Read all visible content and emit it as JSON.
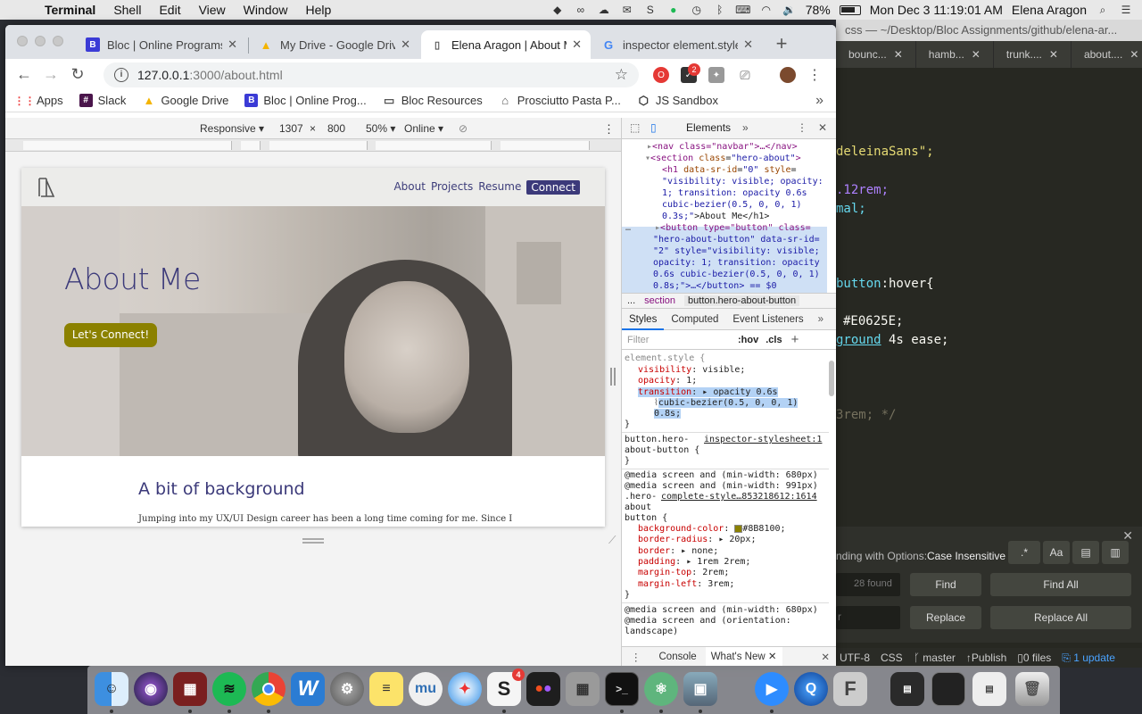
{
  "menubar": {
    "app": "Terminal",
    "menus": [
      "Shell",
      "Edit",
      "View",
      "Window",
      "Help"
    ],
    "battery": "78%",
    "datetime": "Mon Dec 3  11:19:01 AM",
    "user": "Elena Aragon"
  },
  "editor": {
    "title": "css — ~/Desktop/Bloc Assignments/github/elena-ar...",
    "tabs": [
      "bounc...",
      "hamb...",
      "trunk....",
      "about...."
    ],
    "code": {
      "l1": "deleinaSans\";",
      "l2": ".12rem;",
      "l3": "mal;",
      "l4_sel": "button",
      "l4_pseudo": ":hover{",
      "l5": "#E0625E;",
      "l6_prop": "ground",
      "l6_val": " 4s ease;",
      "l7": "3rem; */"
    },
    "find": {
      "options_label": "nding with Options:",
      "options_value": "Case Insensitive",
      "regex": ".*",
      "case": "Aa",
      "found": "28 found",
      "replace_ph": "r",
      "find": "Find",
      "find_all": "Find All",
      "replace": "Replace",
      "replace_all": "Replace All"
    },
    "status": {
      "encoding": "UTF-8",
      "grammar": "CSS",
      "branch": "master",
      "publish": "Publish",
      "files": "0 files",
      "update": "1 update"
    }
  },
  "chrome": {
    "tabs": [
      {
        "label": "Bloc | Online Programs",
        "favicon": "B"
      },
      {
        "label": "My Drive - Google Drive",
        "favicon": "▲"
      },
      {
        "label": "Elena Aragon | About Me",
        "favicon": "📄"
      },
      {
        "label": "inspector element.style",
        "favicon": "G"
      }
    ],
    "url_host": "127.0.0.1",
    "url_path": ":3000/about.html",
    "ext_badge": "2",
    "bookmarks": [
      {
        "label": "Apps",
        "icon": "apps-icon"
      },
      {
        "label": "Slack",
        "icon": "slack-icon"
      },
      {
        "label": "Google Drive",
        "icon": "drive-icon"
      },
      {
        "label": "Bloc | Online Prog...",
        "icon": "bloc-icon"
      },
      {
        "label": "Bloc Resources",
        "icon": "folder-icon"
      },
      {
        "label": "Prosciutto Pasta P...",
        "icon": "page-icon"
      },
      {
        "label": "JS Sandbox",
        "icon": "codepen-icon"
      }
    ]
  },
  "device": {
    "mode": "Responsive",
    "width": "1307",
    "times": "×",
    "height": "800",
    "zoom": "50%",
    "network": "Online"
  },
  "site": {
    "nav": [
      "About",
      "Projects",
      "Resume",
      "Connect"
    ],
    "hero_title": "About Me",
    "cta": "Let's Connect!",
    "section_title": "A bit of background",
    "paragraph": "Jumping into my UX/UI Design career has been a long time coming for me. Since I"
  },
  "devtools": {
    "panel": "Elements",
    "dom": {
      "nav": "<nav class=\"navbar\">…</nav>",
      "section_open_tag": "section",
      "section_class": "hero-about",
      "h1_attr": "data-sr-id",
      "h1_id": "\"0\"",
      "h1_style_a": "\"visibility: visible; opacity:",
      "h1_style_b": "1; transition: opacity 0.6s",
      "h1_style_c": "cubic-bezier(0.5, 0, 0, 1)",
      "h1_style_d": "0.3s;\"",
      "h1_text": ">About Me</h1>",
      "btn_a": "button type=\"button\" class=",
      "btn_b": "\"hero-about-button\" data-sr-id=",
      "btn_c": "\"2\" style=\"visibility: visible;",
      "btn_d": "opacity: 1; transition: opacity",
      "btn_e": "0.6s cubic-bezier(0.5, 0, 0, 1)",
      "btn_f": "0.8s;\">…</button> == $0"
    },
    "crumbs": [
      "...",
      "section",
      "button.hero-about-button"
    ],
    "subtabs": [
      "Styles",
      "Computed",
      "Event Listeners"
    ],
    "filter_placeholder": "Filter",
    "hov": ":hov",
    "cls": ".cls",
    "styles": {
      "element_style": "element.style {",
      "p1": "visibility",
      "v1": "visible;",
      "p2": "opacity",
      "v2": "1;",
      "p3": "transition",
      "v3a": "opacity 0.6s",
      "v3b": "cubic-bezier(0.5, 0, 0, 1)",
      "v3c": "0.8s;",
      "close": "}",
      "rule2_sel_a": "button.hero-",
      "rule2_sel_b": "about-button {",
      "rule2_src": "inspector-stylesheet:1",
      "media1a": "@media screen and (min-width: 680px)",
      "media1b": "@media screen and (min-width: 991px)",
      "rule3_sel_a": ".hero-",
      "rule3_src": "complete-style…853218612:1614",
      "rule3_sel_b": "about",
      "rule3_sel_c": "button {",
      "bg_prop": "background-color",
      "bg_val": "#8B8100;",
      "bg_color": "#8B8100",
      "br_prop": "border-radius",
      "br_val": "20px;",
      "b_prop": "border",
      "b_val": "none;",
      "pad_prop": "padding",
      "pad_val": "1rem 2rem;",
      "mt_prop": "margin-top",
      "mt_val": "2rem;",
      "ml_prop": "margin-left",
      "ml_val": "3rem;",
      "media2a": "@media screen and (min-width: 680px)",
      "media2b": "@media screen and (orientation:",
      "media2c": "landscape)"
    },
    "drawer": [
      "Console",
      "What's New"
    ]
  },
  "dock": {
    "apps": [
      "Finder",
      "Siri",
      "Photo Booth",
      "Spotify",
      "Chrome",
      "Word",
      "System Preferences",
      "Notes",
      "MuseScore",
      "Safari",
      "Slack",
      "Figma",
      "Calculator",
      "Terminal",
      "Atom",
      "Preview",
      "Zoom",
      "QuickTime",
      "Font Book",
      "Trash"
    ],
    "slack_badge": "4"
  },
  "colors": {
    "accent": "#3c3a7a",
    "button": "#8b8100",
    "devtools_blue": "#1a73e8"
  }
}
